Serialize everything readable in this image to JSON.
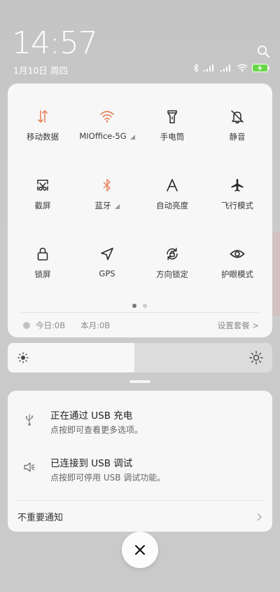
{
  "status": {
    "time": "14:57",
    "date": "1月10日 周四"
  },
  "colors": {
    "accent_active": "#e8825a",
    "icon_default": "#2a2a2a",
    "dot_active": "#777777",
    "dot_inactive": "#cfcfcf",
    "battery": "#6ad64a"
  },
  "quick_settings": {
    "tiles": [
      {
        "label": "移动数据",
        "icon": "mobile-data-icon",
        "active": true
      },
      {
        "label": "MIOffice-5G",
        "icon": "wifi-icon",
        "active": true,
        "has_more": true
      },
      {
        "label": "手电筒",
        "icon": "flashlight-icon",
        "active": false
      },
      {
        "label": "静音",
        "icon": "mute-icon",
        "active": false
      },
      {
        "label": "截屏",
        "icon": "screenshot-icon",
        "active": false
      },
      {
        "label": "蓝牙",
        "icon": "bluetooth-icon",
        "active": true,
        "has_more": true
      },
      {
        "label": "自动亮度",
        "icon": "auto-brightness-icon",
        "active": false
      },
      {
        "label": "飞行模式",
        "icon": "airplane-icon",
        "active": false
      },
      {
        "label": "锁屏",
        "icon": "lock-icon",
        "active": false
      },
      {
        "label": "GPS",
        "icon": "gps-icon",
        "active": false
      },
      {
        "label": "方向锁定",
        "icon": "rotation-lock-icon",
        "active": false
      },
      {
        "label": "护眼模式",
        "icon": "eye-icon",
        "active": false
      }
    ],
    "page_count": 2,
    "current_page": 1,
    "usage_today": "今日:0B",
    "usage_month": "本月:0B",
    "data_plan_link": "设置套餐 >"
  },
  "brightness": {
    "level_fraction": 0.48
  },
  "notifications": [
    {
      "title": "正在通过 USB 充电",
      "body": "点按即可查看更多选项。",
      "icon": "usb-icon"
    },
    {
      "title": "已连接到 USB 调试",
      "body": "点按即可停用 USB 调试功能。",
      "icon": "debug-icon"
    }
  ],
  "unimportant_label": "不重要通知"
}
